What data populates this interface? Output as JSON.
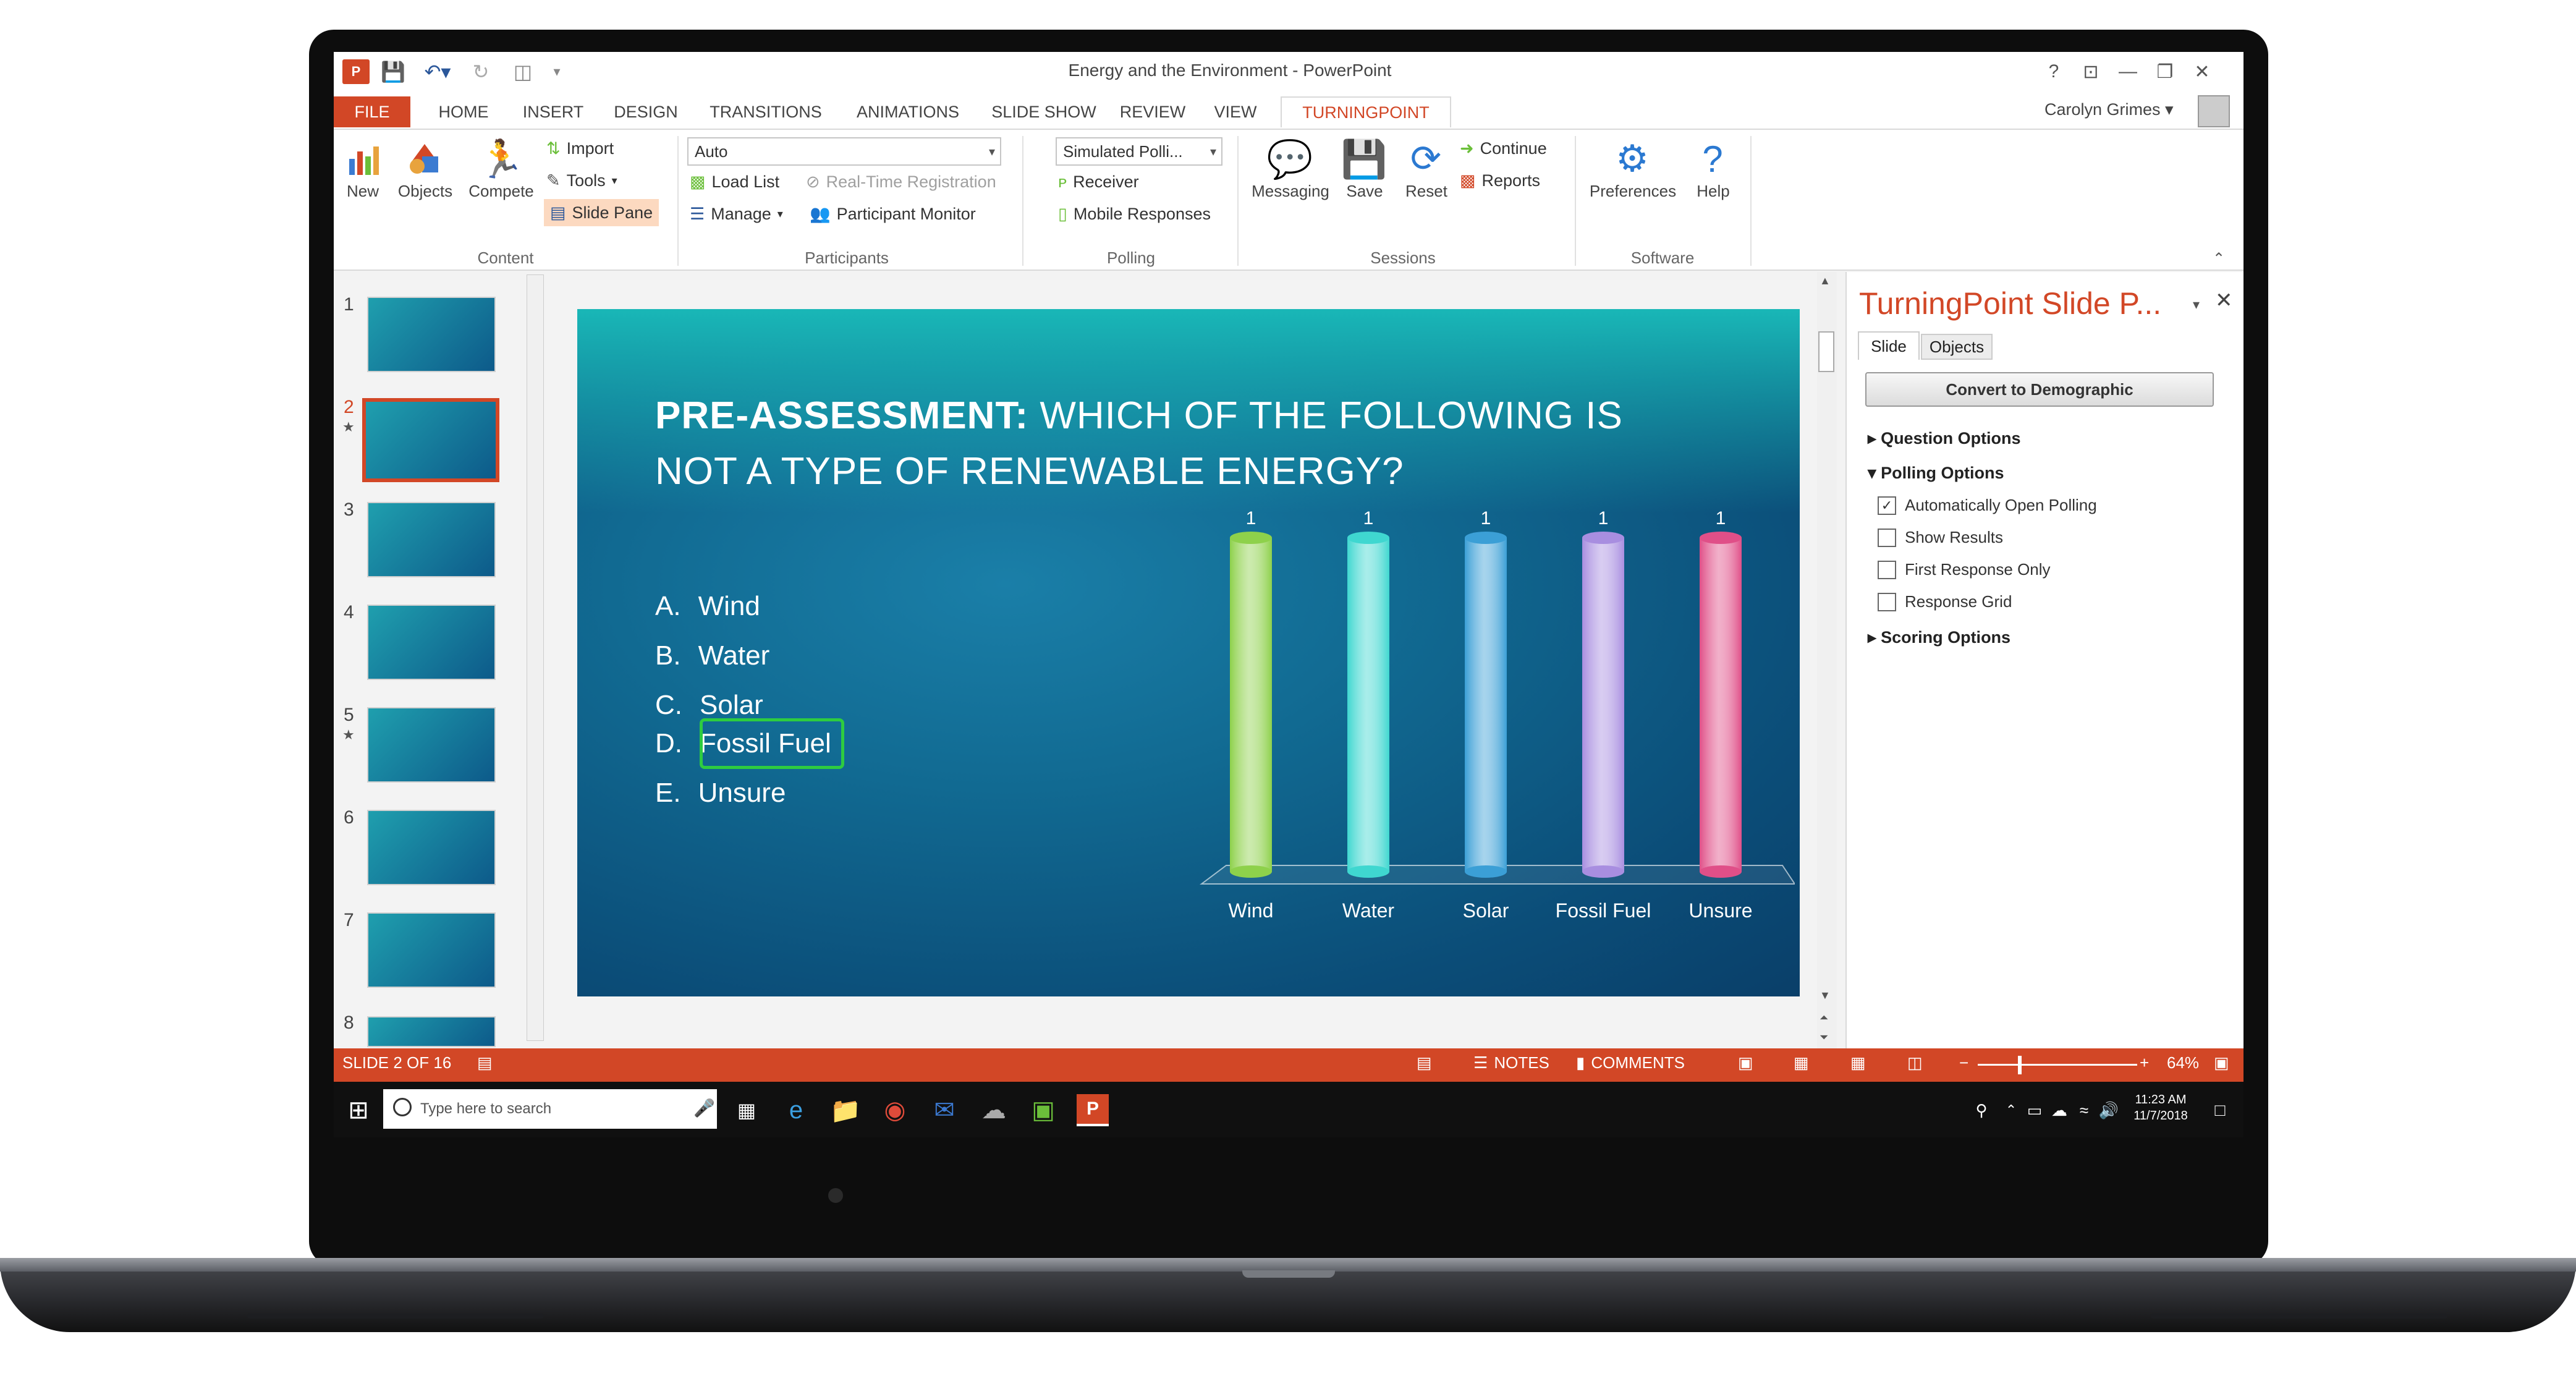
{
  "window": {
    "title": "Energy and the Environment - PowerPoint",
    "user": "Carolyn Grimes",
    "help_glyph": "?",
    "win_buttons": [
      "?",
      "⊡",
      "—",
      "❐",
      "✕"
    ]
  },
  "tabs": [
    {
      "label": "FILE"
    },
    {
      "label": "HOME"
    },
    {
      "label": "INSERT"
    },
    {
      "label": "DESIGN"
    },
    {
      "label": "TRANSITIONS"
    },
    {
      "label": "ANIMATIONS"
    },
    {
      "label": "SLIDE SHOW"
    },
    {
      "label": "REVIEW"
    },
    {
      "label": "VIEW"
    },
    {
      "label": "TURNINGPOINT"
    }
  ],
  "ribbon": {
    "content": {
      "new": "New",
      "objects": "Objects",
      "compete": "Compete",
      "import": "Import",
      "tools": "Tools",
      "slide_pane": "Slide Pane",
      "group": "Content"
    },
    "participants": {
      "combo": "Auto",
      "load_list": "Load List",
      "realtime": "Real-Time Registration",
      "manage": "Manage",
      "monitor": "Participant Monitor",
      "group": "Participants"
    },
    "polling": {
      "combo": "Simulated Polli...",
      "receiver": "Receiver",
      "mobile": "Mobile Responses",
      "group": "Polling"
    },
    "sessions": {
      "messaging": "Messaging",
      "save": "Save",
      "reset": "Reset",
      "continue": "Continue",
      "reports": "Reports",
      "group": "Sessions"
    },
    "software": {
      "preferences": "Preferences",
      "help": "Help",
      "group": "Software"
    }
  },
  "thumbnails": {
    "numbers": [
      "1",
      "2",
      "3",
      "4",
      "5",
      "6",
      "7",
      "8"
    ],
    "selected": "2"
  },
  "slide": {
    "title_bold": "PRE-ASSESSMENT:",
    "title_rest": " WHICH OF THE FOLLOWING IS NOT A TYPE OF RENEWABLE ENERGY?",
    "answers": [
      {
        "letter": "A.",
        "text": "Wind"
      },
      {
        "letter": "B.",
        "text": "Water"
      },
      {
        "letter": "C.",
        "text": "Solar"
      },
      {
        "letter": "D.",
        "text": "Fossil Fuel"
      },
      {
        "letter": "E.",
        "text": "Unsure"
      }
    ]
  },
  "chart_data": {
    "type": "bar",
    "categories": [
      "Wind",
      "Water",
      "Solar",
      "Fossil Fuel",
      "Unsure"
    ],
    "values": [
      1,
      1,
      1,
      1,
      1
    ],
    "colors": [
      "#8ed14b",
      "#3fd7d0",
      "#3b9fd6",
      "#a88ee0",
      "#e04f88"
    ],
    "data_labels": [
      "1",
      "1",
      "1",
      "1",
      "1"
    ]
  },
  "taskpane": {
    "title": "TurningPoint Slide P...",
    "tabs": [
      "Slide",
      "Objects"
    ],
    "convert_button": "Convert to Demographic",
    "question_options": "Question Options",
    "polling_options": "Polling Options",
    "options": [
      {
        "label": "Automatically Open Polling",
        "checked": "✓"
      },
      {
        "label": "Show Results",
        "checked": ""
      },
      {
        "label": "First Response Only",
        "checked": ""
      },
      {
        "label": "Response Grid",
        "checked": ""
      }
    ],
    "scoring_options": "Scoring Options"
  },
  "status": {
    "slide": "SLIDE 2 OF 16",
    "notes": "NOTES",
    "comments": "COMMENTS",
    "zoom": "64%"
  },
  "taskbar": {
    "search_placeholder": "Type here to search",
    "time": "11:23 AM",
    "date": "11/7/2018"
  }
}
